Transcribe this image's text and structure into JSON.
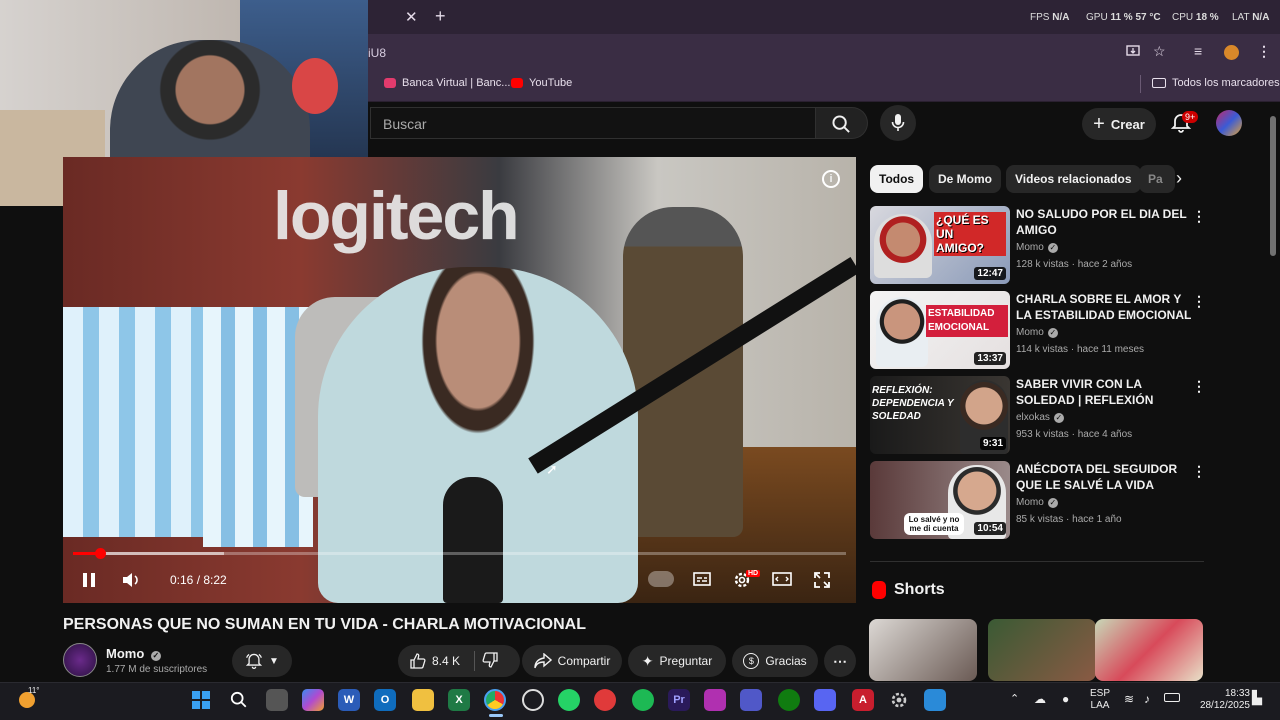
{
  "browser": {
    "tab_close": "✕",
    "tab_new": "+",
    "url_fragment": "iU8",
    "overlay": {
      "fps_label": "FPS",
      "fps_value": "N/A",
      "gpu_label": "GPU",
      "gpu_value": "11 % 57 °C",
      "cpu_label": "CPU",
      "cpu_value": "18 %",
      "lat_label": "LAT",
      "lat_value": "N/A"
    },
    "bookmarks": [
      {
        "label": "Banca Virtual | Banc...",
        "icon": "bank-favicon"
      },
      {
        "label": "YouTube",
        "icon": "youtube-favicon"
      }
    ],
    "all_bookmarks": "Todos los marcadores"
  },
  "youtube": {
    "search_placeholder": "Buscar",
    "create_label": "Crear",
    "notifications_badge": "9+"
  },
  "player": {
    "current_time": "0:16 / 8:22",
    "progress": 0.035,
    "buffered": 0.195,
    "hd_badge": "HD",
    "video_overlay_text": "logitech"
  },
  "video": {
    "title": "PERSONAS QUE NO SUMAN EN TU VIDA - CHARLA MOTIVACIONAL",
    "channel_name": "Momo",
    "subscribers": "1.77 M de suscriptores",
    "likes": "8.4 K",
    "share_label": "Compartir",
    "ask_label": "Preguntar",
    "thanks_label": "Gracias"
  },
  "sidebar": {
    "chips": [
      "Todos",
      "De Momo",
      "Videos relacionados",
      "Pa"
    ],
    "recommendations": [
      {
        "title": "NO SALUDO POR EL DIA DEL AMIGO",
        "channel": "Momo",
        "meta": "128 k vistas · hace 2 años",
        "duration": "12:47",
        "thumb_text": "¿QUÉ ES UN AMIGO?"
      },
      {
        "title": "CHARLA SOBRE EL AMOR Y LA ESTABILIDAD EMOCIONAL",
        "channel": "Momo",
        "meta": "114 k vistas · hace 11 meses",
        "duration": "13:37",
        "thumb_text": "ESTABILIDAD EMOCIONAL"
      },
      {
        "title": "SABER VIVIR CON LA SOLEDAD | REFLEXIÓN",
        "channel": "elxokas",
        "meta": "953 k vistas · hace 4 años",
        "duration": "9:31",
        "thumb_text": "REFLEXIÓN: DEPENDENCIA Y SOLEDAD"
      },
      {
        "title": "ANÉCDOTA DEL SEGUIDOR QUE LE SALVÉ LA VIDA",
        "channel": "Momo",
        "meta": "85 k vistas · hace 1 año",
        "duration": "10:54",
        "thumb_text": "Lo salvé y no me di cuenta"
      }
    ],
    "shorts_heading": "Shorts"
  },
  "taskbar": {
    "weather": "11°",
    "lang_top": "ESP",
    "lang_bottom": "LAA",
    "time": "18:33",
    "date": "28/12/2025"
  },
  "colors": {
    "accent_red": "#ff0000",
    "chrome_bg": "#3a2d44",
    "yt_bg": "#0f0f0f"
  }
}
